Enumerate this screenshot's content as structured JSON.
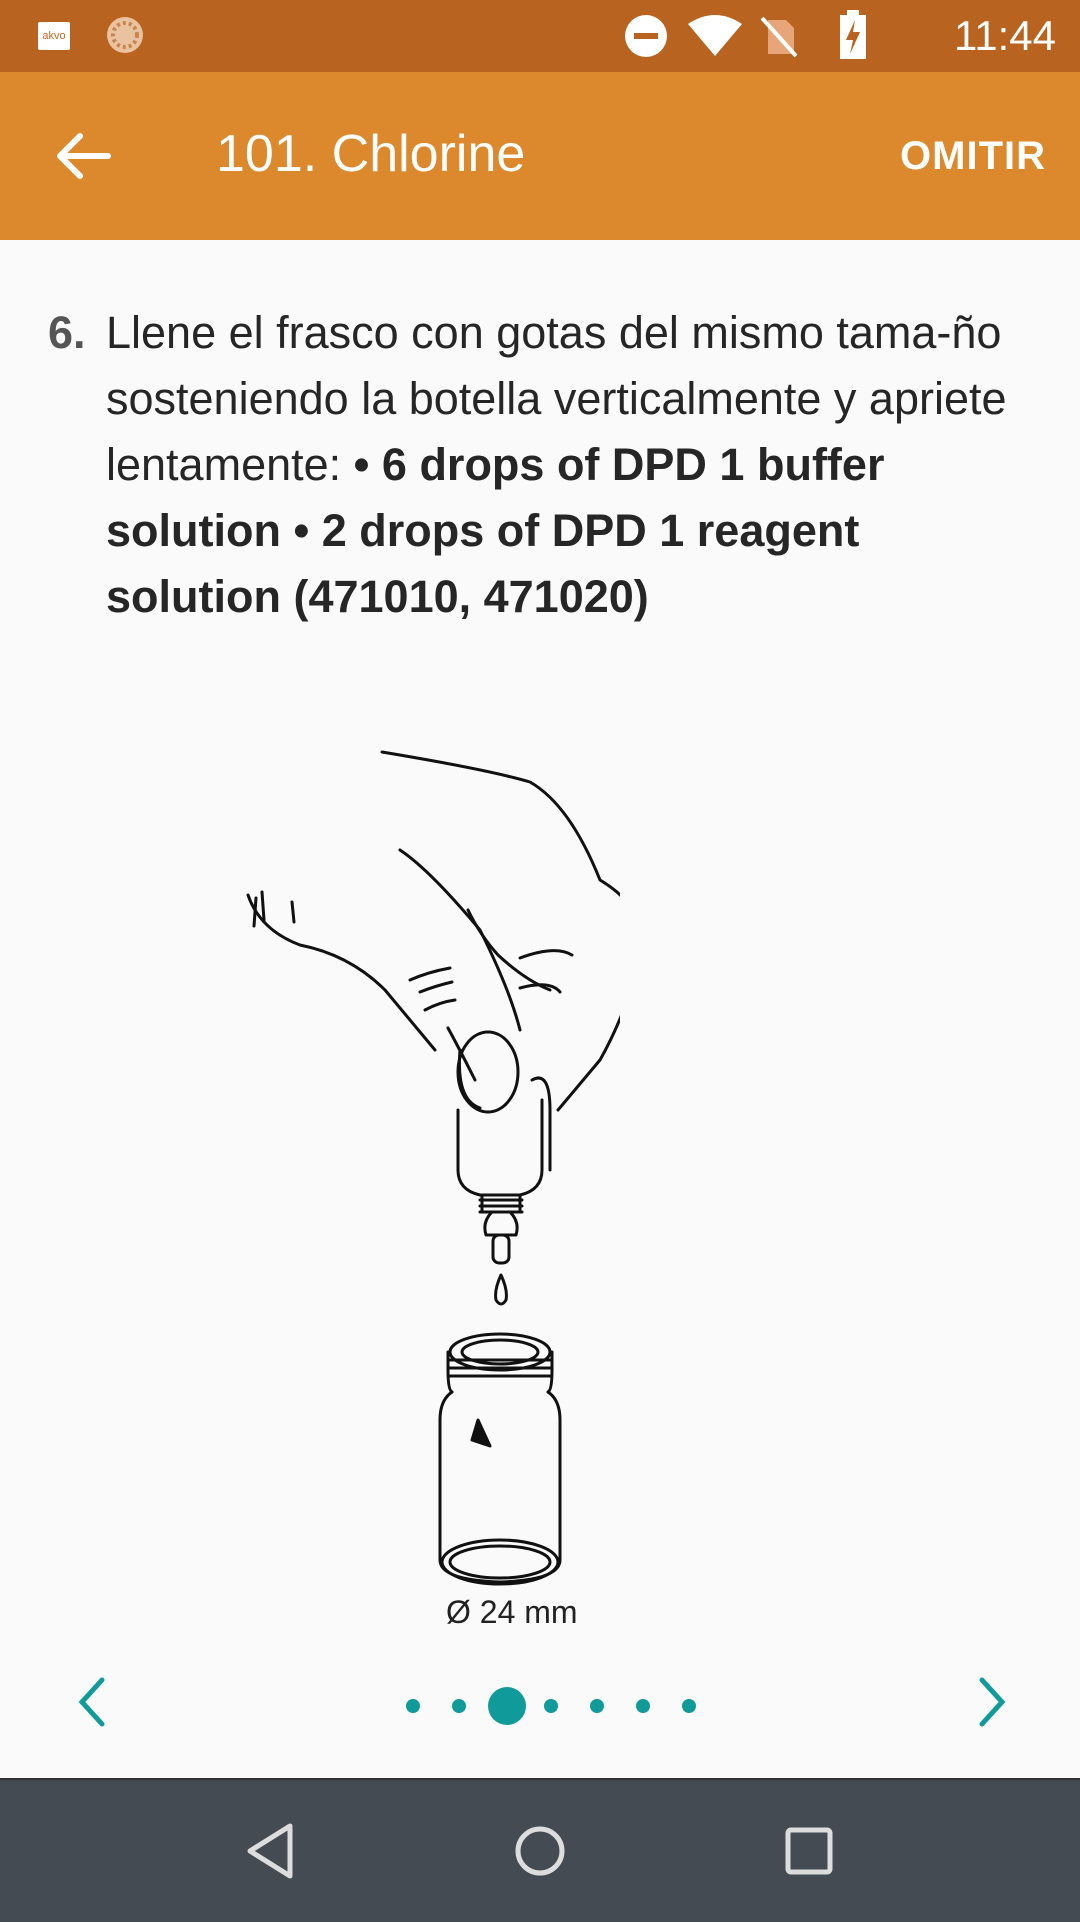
{
  "status_bar": {
    "app_badge": "akvo",
    "time": "11:44",
    "icons": [
      "do-not-disturb-icon",
      "wifi-icon",
      "no-sim-icon",
      "battery-charging-icon"
    ]
  },
  "app_bar": {
    "back_icon": "arrow-back-icon",
    "title": "101. Chlorine",
    "skip_label": "OMITIR"
  },
  "instruction": {
    "number": "6.",
    "text_plain": "Llene el frasco con gotas del mismo tama-ño sosteniendo la botella verticalmente y apriete lentamente: ",
    "text_bold": "• 6 drops of DPD 1 buffer solution • 2 drops of DPD 1 reagent solution (471010, 471020)"
  },
  "illustration": {
    "label": "Ø 24 mm"
  },
  "pager": {
    "prev_icon": "chevron-left-icon",
    "next_icon": "chevron-right-icon",
    "total_pages": 7,
    "current_page": 3,
    "accent_color": "#109a9a"
  },
  "nav_bar": {
    "buttons": [
      "back-triangle-icon",
      "home-circle-icon",
      "recents-square-icon"
    ]
  }
}
